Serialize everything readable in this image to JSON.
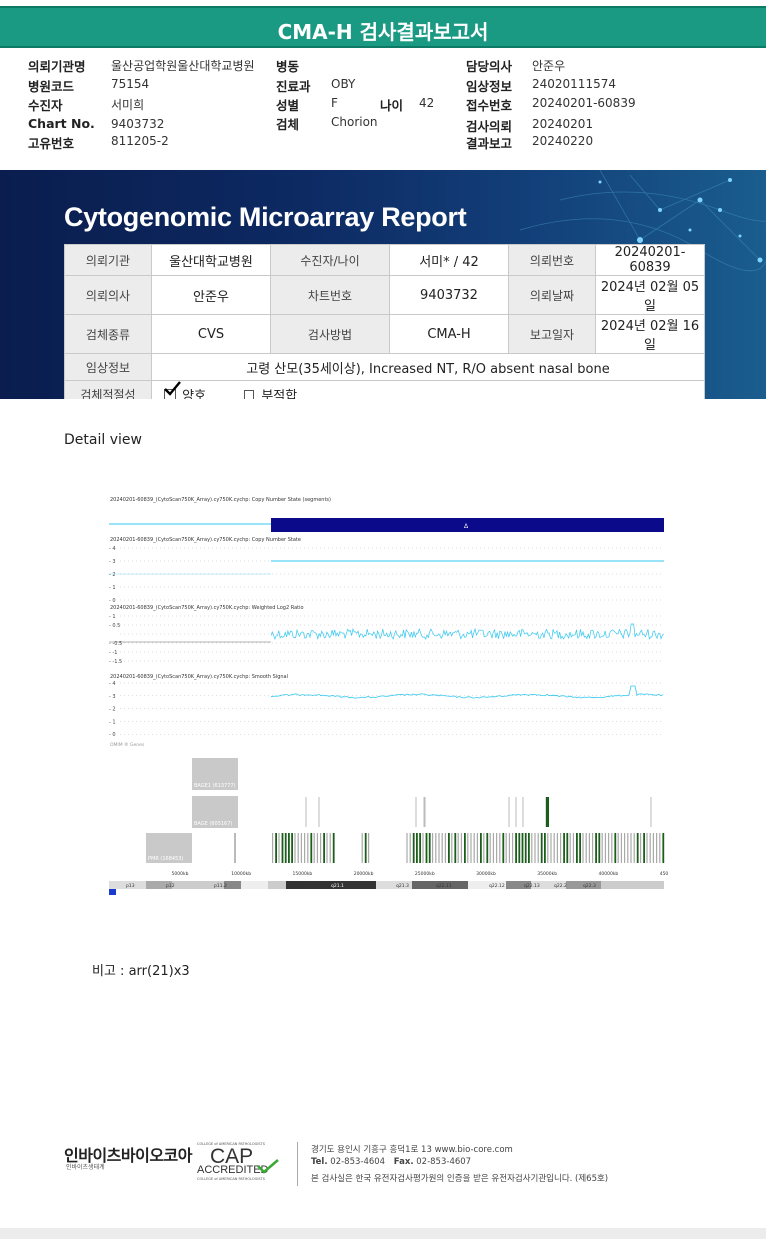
{
  "report": {
    "title": "CMA-H 검사결과보고서"
  },
  "header": {
    "labels": {
      "org": "의뢰기관명",
      "code": "병원코드",
      "patient": "수진자",
      "chart": "Chart No.",
      "uid": "고유번호",
      "ward": "병동",
      "dept": "진료과",
      "sex": "성별",
      "age": "나이",
      "specimen": "검체",
      "doctor": "담당의사",
      "clinical": "임상정보",
      "reception": "접수번호",
      "request": "검사의뢰",
      "result": "결과보고"
    },
    "values": {
      "org": "울산공업학원울산대학교병원",
      "code": "75154",
      "patient": "서미희",
      "chart": "9403732",
      "uid": "811205-2",
      "ward": "",
      "dept": "OBY",
      "sex": "F",
      "age": "42",
      "specimen": "Chorion",
      "doctor": "안준우",
      "clinical": "24020111574",
      "reception": "20240201-60839",
      "request": "20240201",
      "result": "20240220"
    }
  },
  "banner": {
    "title": "Cytogenomic Microarray Report",
    "table": {
      "k_org": "의뢰기관",
      "v_org": "울산대학교병원",
      "k_patient": "수진자/나이",
      "v_patient": "서미* / 42",
      "k_no": "의뢰번호",
      "v_no": "20240201-60839",
      "k_doctor": "의뢰의사",
      "v_doctor": "안준우",
      "k_chart": "차트번호",
      "v_chart": "9403732",
      "k_date": "의뢰날짜",
      "v_date": "2024년 02월 05일",
      "k_type": "검체종류",
      "v_type": "CVS",
      "k_method": "검사방법",
      "v_method": "CMA-H",
      "k_rdate": "보고일자",
      "v_rdate": "2024년 02월 16일",
      "k_clinical": "임상정보",
      "v_clinical": "고령 산모(35세이상), Increased NT, R/O absent nasal bone",
      "k_adequacy": "검체적절성",
      "opt_good": "양호",
      "opt_bad": "부적합"
    }
  },
  "detail_title": "Detail view",
  "chart_data": {
    "type": "line",
    "panels": [
      {
        "label": "20240201-60839_(CytoScan750K_Array).cy750K.cychp: Copy Number State (segments)",
        "segment_label": "Δ"
      },
      {
        "label": "20240201-60839_(CytoScan750K_Array).cy750K.cychp: Copy Number State",
        "yticks": [
          "4",
          "3",
          "2",
          "1",
          "0"
        ],
        "value_left": 2,
        "value_right": 3
      },
      {
        "label": "20240201-60839_(CytoScan750K_Array).cy750K.cychp: Weighted Log2 Ratio",
        "yticks": [
          "1",
          "0.5",
          "",
          "-0.5",
          "-1",
          "-1.5"
        ]
      },
      {
        "label": "20240201-60839_(CytoScan750K_Array).cy750K.cychp: Smooth Signal",
        "yticks": [
          "4",
          "3",
          "2",
          "1",
          "0"
        ]
      }
    ],
    "gene_label": "OMIM ® Genes",
    "genes": [
      "BAGE1 (613777)",
      "BAGE (605167)",
      "PMR (168453)"
    ],
    "x_ticks": [
      "5000kb",
      "10000kb",
      "15000kb",
      "20000kb",
      "25000kb",
      "30000kb",
      "35000kb",
      "40000kb",
      "45000kb"
    ],
    "bands": [
      "p13",
      "p12",
      "p11.2",
      "q11.2",
      "q21.1",
      "q21.3",
      "q22.11",
      "q22.12",
      "q22.13",
      "q22.2",
      "q22.3"
    ],
    "colors": {
      "segment": "#0a0a8a",
      "signal": "#33c8f0",
      "ideogram_dark": "#333333"
    }
  },
  "remark": {
    "label": "비고 :",
    "value": "arr(21)x3"
  },
  "footer": {
    "company": "인바이츠바이오코아",
    "company_sub": "인바이츠생태계",
    "cap_top": "COLLEGE of AMERICAN PATHOLOGISTS",
    "cap": "CAP",
    "cap_acc": "ACCREDITED",
    "cap_bottom": "COLLEGE of AMERICAN PATHOLOGISTS",
    "address": "경기도 용인시 기흥구 흥덕1로 13   www.bio-core.com",
    "tel_label": "Tel.",
    "tel": "02-853-4604",
    "fax_label": "Fax.",
    "fax": "02-853-4607",
    "cert": "본 검사실은 한국 유전자검사평가원의 인증을 받은 유전자검사기관입니다. (제65호)"
  }
}
